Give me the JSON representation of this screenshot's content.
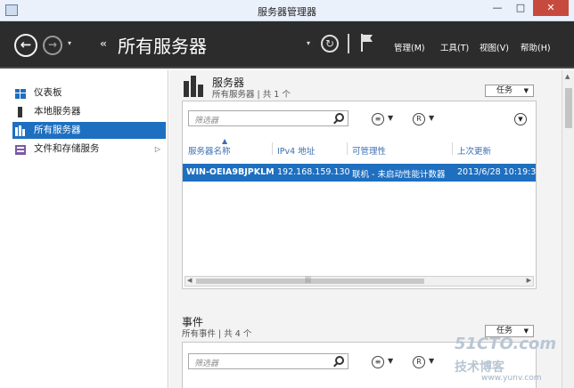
{
  "window": {
    "title": "服务器管理器",
    "min": "—",
    "max": "□",
    "close": "✕"
  },
  "toolbar": {
    "back": "←",
    "forward": "→",
    "dropdown": "▾",
    "breadcrumb_arrows": "‹‹",
    "page_title": "所有服务器",
    "refresh": "↻",
    "menus": {
      "manage": "管理(M)",
      "tools": "工具(T)",
      "view": "视图(V)",
      "help": "帮助(H)"
    }
  },
  "sidebar": {
    "items": [
      {
        "label": "仪表板",
        "icon": "dashboard-icon"
      },
      {
        "label": "本地服务器",
        "icon": "local-server-icon"
      },
      {
        "label": "所有服务器",
        "icon": "all-servers-icon",
        "active": true
      },
      {
        "label": "文件和存储服务",
        "icon": "file-storage-icon",
        "arrow": "▷"
      }
    ]
  },
  "servers_section": {
    "title": "服务器",
    "subtitle": "所有服务器 | 共 1 个",
    "tasks_label": "任务",
    "filter_placeholder": "筛选器",
    "columns": [
      "服务器名称",
      "IPv4 地址",
      "可管理性",
      "上次更新"
    ],
    "rows": [
      {
        "name": "WIN-OEIA9BJPKLM",
        "ip": "192.168.159.130",
        "manageability": "联机 - 未启动性能计数器",
        "last_update": "2013/6/28 10:19:3..."
      }
    ]
  },
  "events_section": {
    "title": "事件",
    "subtitle": "所有事件 | 共 4 个",
    "tasks_label": "任务",
    "filter_placeholder": "筛选器"
  },
  "watermark": {
    "logo": "51CTO.com",
    "sub": "技术博客",
    "url": "www.yunv.com"
  },
  "colors": {
    "accent": "#1e6fc0",
    "toolbar": "#2c2c2c",
    "close": "#c74a3f"
  }
}
